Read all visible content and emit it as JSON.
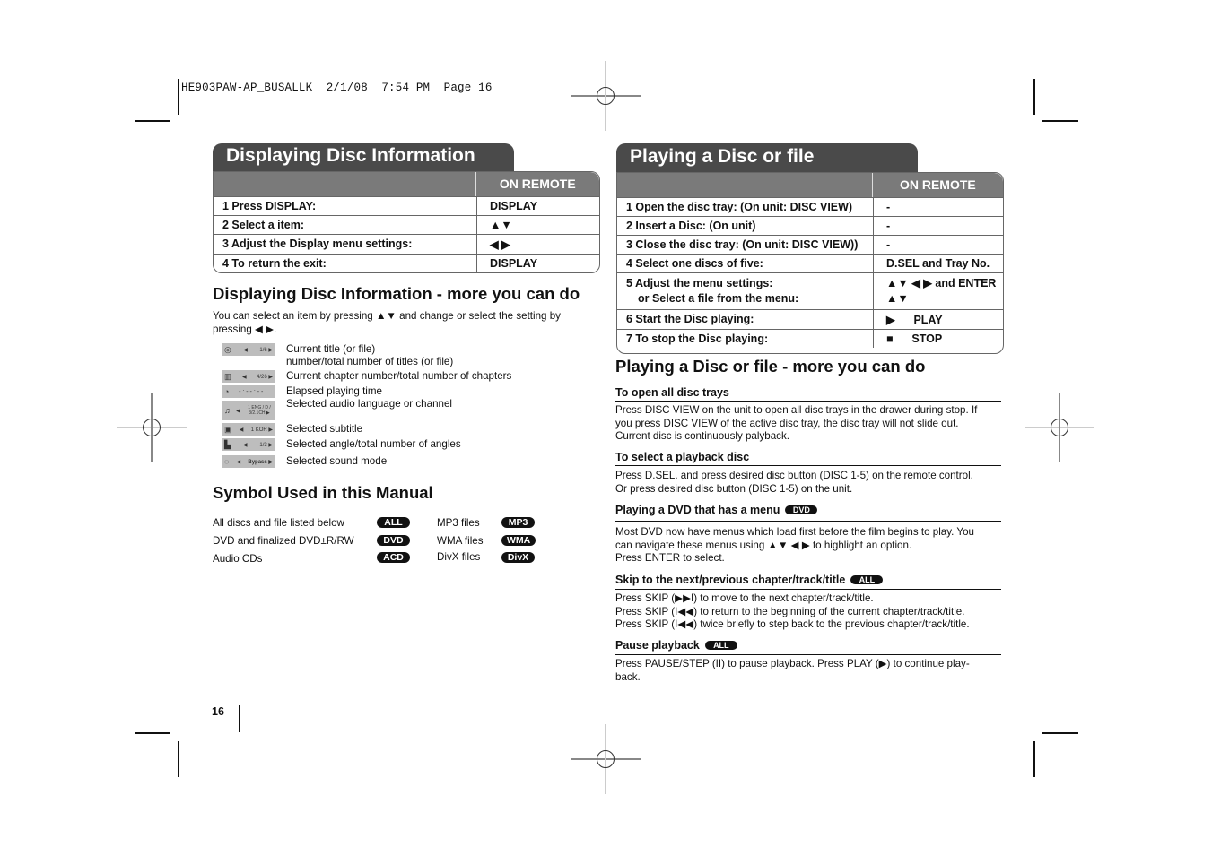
{
  "slug": "HE903PAW-AP_BUSALLK  2/1/08  7:54 PM  Page 16",
  "page_number": "16",
  "left": {
    "title": "Displaying Disc Information",
    "table": {
      "header_remote": "ON REMOTE",
      "rows": [
        {
          "step": "1  Press DISPLAY:",
          "remote": "DISPLAY"
        },
        {
          "step": "2  Select a item:",
          "remote": "▲▼"
        },
        {
          "step": "3  Adjust the Display menu settings:",
          "remote": "◀ ▶"
        },
        {
          "step": "4  To return the exit:",
          "remote": "DISPLAY"
        }
      ]
    },
    "more_title": "Displaying Disc Information - more you can do",
    "more_intro_1": "You can select an item by pressing ▲▼ and change or select the setting by",
    "more_intro_2": "pressing ◀ ▶.",
    "display_items": [
      {
        "icon": "title-disc-icon",
        "osd_left": "◀",
        "osd_value": "1/6 ▶",
        "desc_1": "Current title (or file)",
        "desc_2": "number/total number of titles (or file)"
      },
      {
        "icon": "chapter-icon",
        "osd_left": "◀",
        "osd_value": "4/26 ▶",
        "desc_1": "Current chapter number/total number of chapters"
      },
      {
        "icon": "clock-icon",
        "osd_left": "",
        "osd_value": "- : - - : - -",
        "desc_1": "Elapsed playing time"
      },
      {
        "icon": "audio-icon",
        "osd_left": "◀",
        "osd_value": "1 ENG / D / 3/2.1CH ▶",
        "desc_1": "Selected audio language or channel"
      },
      {
        "icon": "subtitle-icon",
        "osd_left": "◀",
        "osd_value": "1 KOR ▶",
        "desc_1": "Selected subtitle"
      },
      {
        "icon": "angle-icon",
        "osd_left": "◀",
        "osd_value": "1/3 ▶",
        "desc_1": "Selected angle/total number of angles"
      },
      {
        "icon": "sound-mode-icon",
        "osd_left": "◀",
        "osd_value": "Bypass ▶",
        "desc_1": "Selected sound mode"
      }
    ],
    "symbols_title": "Symbol Used in this Manual",
    "symbols": [
      {
        "label": "All discs and file listed below",
        "badge": "ALL"
      },
      {
        "label": "DVD and finalized DVD±R/RW",
        "badge": "DVD"
      },
      {
        "label": "Audio CDs",
        "badge": "ACD"
      },
      {
        "label": "MP3 files",
        "badge": "MP3"
      },
      {
        "label": "WMA files",
        "badge": "WMA"
      },
      {
        "label": "DivX files",
        "badge": "DivX"
      }
    ]
  },
  "right": {
    "title": "Playing a Disc or file",
    "table": {
      "header_remote": "ON REMOTE",
      "rows": [
        {
          "step": "1  Open the disc tray: (On unit: DISC VIEW)",
          "remote": "-"
        },
        {
          "step": "2  Insert a Disc: (On unit)",
          "remote": "-"
        },
        {
          "step": "3  Close the disc tray: (On unit: DISC VIEW))",
          "remote": "-"
        },
        {
          "step": "4  Select one discs of five:",
          "remote": "D.SEL and Tray No."
        },
        {
          "step": "5  Adjust the menu settings:",
          "step_2": "or Select a file from the menu:",
          "remote": "▲▼ ◀ ▶ and ENTER",
          "remote_2": "▲▼"
        },
        {
          "step": "6  Start the Disc playing:",
          "remote": "▶      PLAY"
        },
        {
          "step": "7  To stop the Disc playing:",
          "remote": "■      STOP"
        }
      ]
    },
    "more_title": "Playing a Disc or file - more you can do",
    "sections": [
      {
        "heading": "To open all disc trays",
        "badge": "",
        "lines": [
          "Press DISC VIEW on the unit to open all disc trays in the drawer during stop. If",
          "you press DISC VIEW of the active disc tray, the disc tray will not slide out.",
          "Current disc is continuously palyback."
        ]
      },
      {
        "heading": "To select a playback disc",
        "badge": "",
        "lines": [
          "Press D.SEL. and press desired disc button (DISC 1-5) on the remote control.",
          "Or press desired disc button (DISC 1-5) on the unit."
        ]
      },
      {
        "heading": "Playing a DVD that has a menu",
        "badge": "DVD",
        "lines": [
          "Most DVD now have menus which load first before the film begins to play. You",
          "can navigate these menus using ▲▼ ◀ ▶ to highlight an option.",
          "Press ENTER to select."
        ]
      },
      {
        "heading": "Skip to the next/previous chapter/track/title",
        "badge": "ALL",
        "lines": [
          "Press SKIP (▶▶I) to move to the next chapter/track/title.",
          "Press SKIP (I◀◀) to return to the beginning of the current chapter/track/title.",
          "Press SKIP (I◀◀) twice briefly to step back to the previous chapter/track/title."
        ]
      },
      {
        "heading": "Pause playback",
        "badge": "ALL",
        "lines": [
          "Press PAUSE/STEP (II) to pause playback. Press PLAY (▶) to continue play-",
          "back."
        ]
      }
    ]
  }
}
